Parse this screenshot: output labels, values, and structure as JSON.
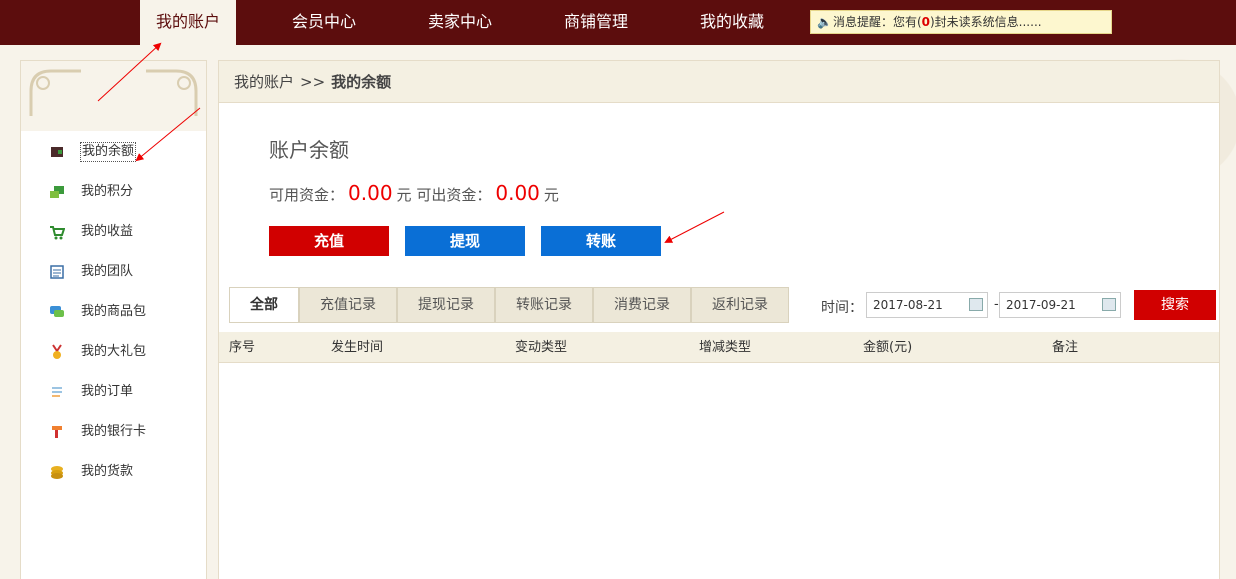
{
  "nav": {
    "items": [
      {
        "label": "我的账户"
      },
      {
        "label": "会员中心"
      },
      {
        "label": "卖家中心"
      },
      {
        "label": "商铺管理"
      },
      {
        "label": "我的收藏"
      }
    ],
    "notice": {
      "prefix": "消息提醒：您有(",
      "count": "0",
      "suffix": ")封未读系统信息......"
    }
  },
  "sidebar": {
    "items": [
      {
        "label": "我的余额",
        "icon": "wallet-icon"
      },
      {
        "label": "我的积分",
        "icon": "points-icon"
      },
      {
        "label": "我的收益",
        "icon": "cart-icon"
      },
      {
        "label": "我的团队",
        "icon": "team-icon"
      },
      {
        "label": "我的商品包",
        "icon": "chat-bubble-icon"
      },
      {
        "label": "我的大礼包",
        "icon": "medal-icon"
      },
      {
        "label": "我的订单",
        "icon": "list-icon"
      },
      {
        "label": "我的银行卡",
        "icon": "bank-card-icon"
      },
      {
        "label": "我的货款",
        "icon": "coins-icon"
      }
    ]
  },
  "breadcrumb": {
    "root": "我的账户",
    "sep": ">>",
    "current": "我的余额"
  },
  "balance": {
    "title": "账户余额",
    "available_label": "可用资金：",
    "available_amount": "0.00",
    "unit": "元",
    "withdrawable_label": "可出资金：",
    "withdrawable_amount": "0.00"
  },
  "actions": {
    "recharge": "充值",
    "withdraw": "提现",
    "transfer": "转账"
  },
  "tabs": [
    {
      "label": "全部"
    },
    {
      "label": "充值记录"
    },
    {
      "label": "提现记录"
    },
    {
      "label": "转账记录"
    },
    {
      "label": "消费记录"
    },
    {
      "label": "返利记录"
    }
  ],
  "filter": {
    "time_label": "时间：",
    "start_date": "2017-08-21",
    "end_date": "2017-09-21",
    "date_sep": "-",
    "search_label": "搜索"
  },
  "table": {
    "columns": [
      "序号",
      "发生时间",
      "变动类型",
      "增减类型",
      "金额(元)",
      "备注"
    ]
  },
  "colors": {
    "nav_bg": "#5c0d0d",
    "accent_red": "#d10000",
    "accent_blue": "#0a6fd6",
    "amount_red": "#e00000"
  }
}
